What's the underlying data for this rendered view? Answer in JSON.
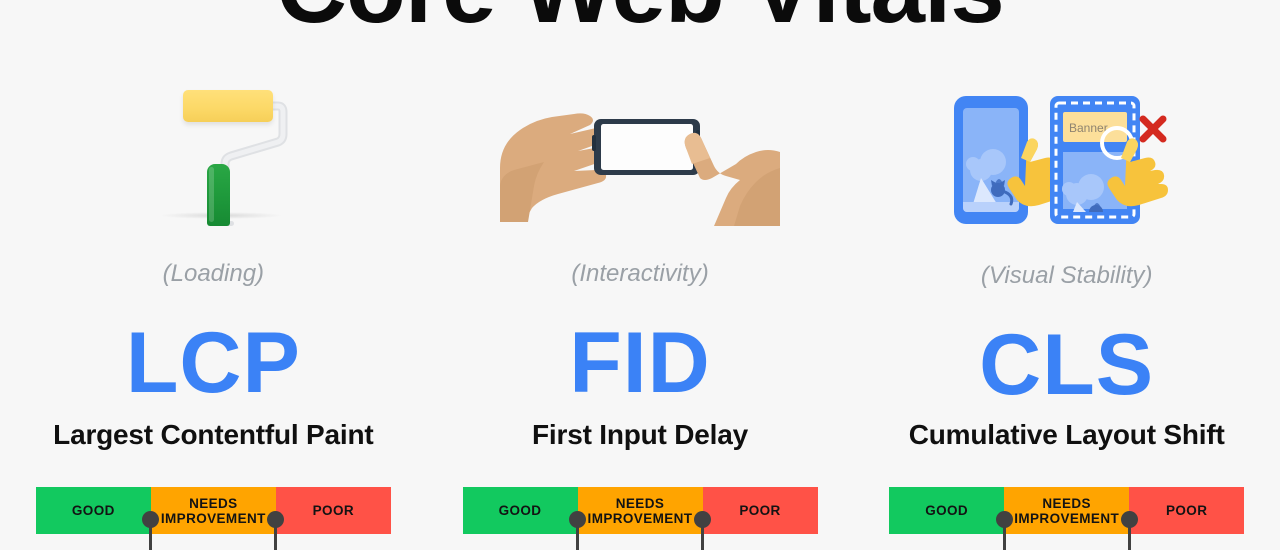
{
  "page": {
    "title": "Core Web Vitals",
    "background_color": "#f7f7f7"
  },
  "colors": {
    "accent_blue": "#3b82f6",
    "good_green": "#12c95f",
    "needs_improvement_orange": "#ffa400",
    "poor_red": "#ff5247",
    "subtitle_gray": "#9aa0a6",
    "pin_dark": "#414141",
    "phone_blue": "#4285f4",
    "phone_screen_blue": "#8ab4f8",
    "roller_yellow": "#fcd968",
    "roller_handle_green": "#1f9a3c"
  },
  "metrics": [
    {
      "id": "lcp",
      "icon": "paint-roller-icon",
      "subtitle": "(Loading)",
      "acronym": "LCP",
      "full_name": "Largest Contentful Paint",
      "thresholds": {
        "good": "GOOD",
        "needs_improvement": "NEEDS IMPROVEMENT",
        "poor": "POOR"
      }
    },
    {
      "id": "fid",
      "icon": "hands-tapping-phone-icon",
      "subtitle": "(Interactivity)",
      "acronym": "FID",
      "full_name": "First Input Delay",
      "thresholds": {
        "good": "GOOD",
        "needs_improvement": "NEEDS IMPROVEMENT",
        "poor": "POOR"
      }
    },
    {
      "id": "cls",
      "icon": "layout-shift-phones-icon",
      "subtitle": "(Visual Stability)",
      "acronym": "CLS",
      "full_name": "Cumulative Layout Shift",
      "banner_label": "Banner",
      "error_mark": "✗",
      "thresholds": {
        "good": "GOOD",
        "needs_improvement": "NEEDS IMPROVEMENT",
        "poor": "POOR"
      }
    }
  ]
}
